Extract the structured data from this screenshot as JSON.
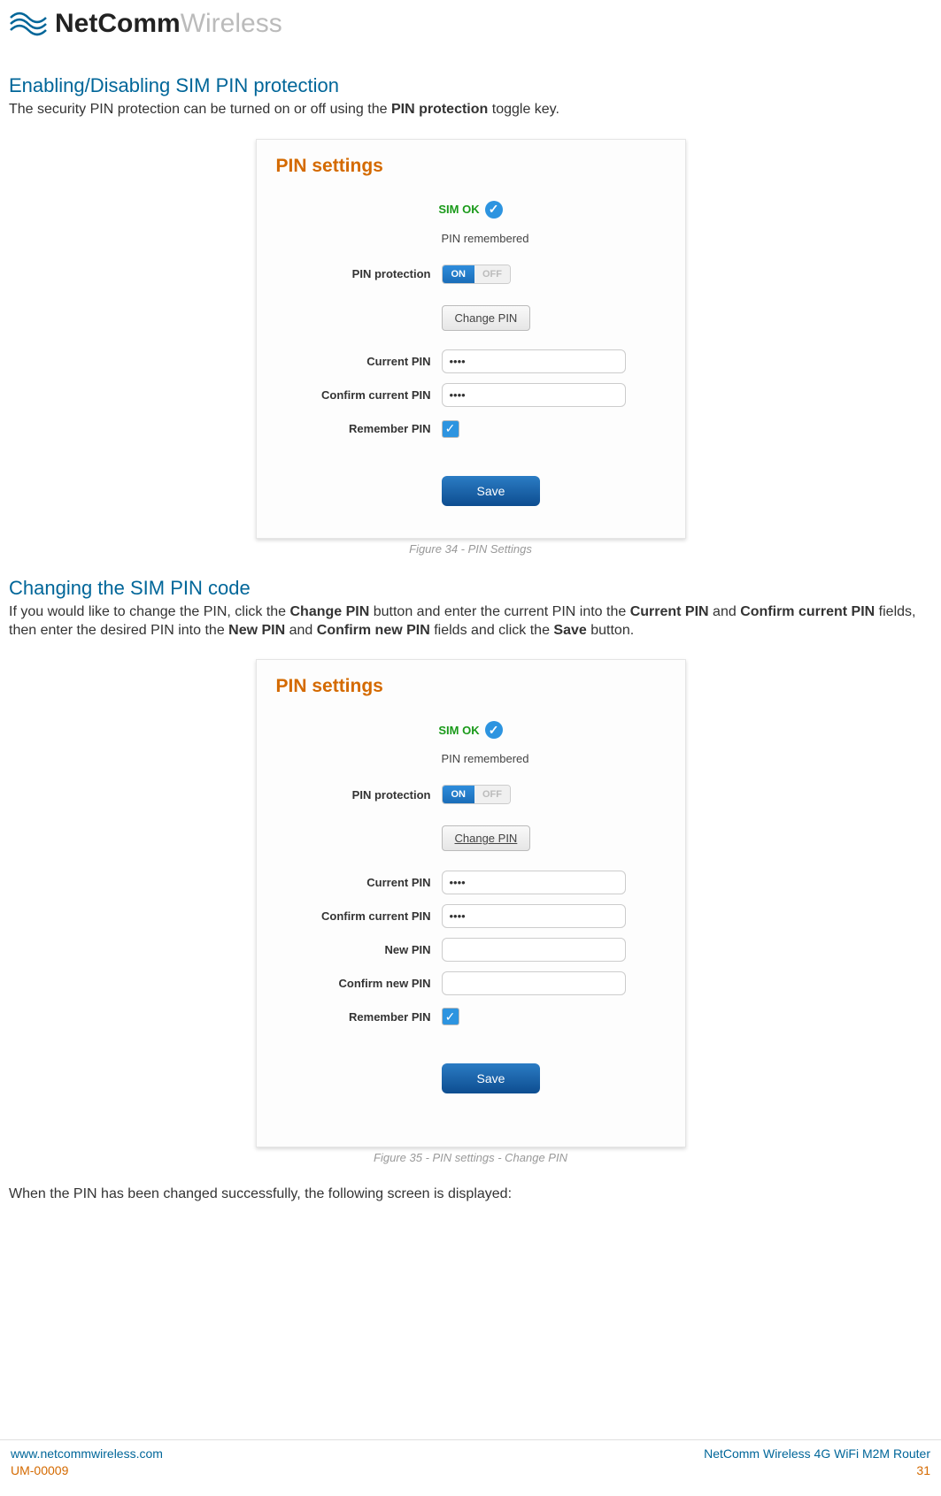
{
  "logo": {
    "bold": "NetComm",
    "light": "Wireless"
  },
  "section1": {
    "heading": "Enabling/Disabling SIM PIN protection",
    "text_pre": "The security PIN protection can be turned on or off using the ",
    "bold1": "PIN protection",
    "text_post": " toggle key."
  },
  "panel1": {
    "title": "PIN settings",
    "sim_ok": "SIM OK",
    "pin_remembered": "PIN remembered",
    "pin_protection_label": "PIN protection",
    "toggle_on": "ON",
    "toggle_off": "OFF",
    "change_pin": "Change PIN",
    "current_pin_label": "Current PIN",
    "current_pin_value": "••••",
    "confirm_current_label": "Confirm current PIN",
    "confirm_current_value": "••••",
    "remember_label": "Remember PIN",
    "save": "Save"
  },
  "figure1_caption": "Figure 34 - PIN Settings",
  "section2": {
    "heading": "Changing the SIM PIN code",
    "t1": "If you would like to change the PIN, click the ",
    "b1": "Change PIN",
    "t2": " button and enter the current PIN into the ",
    "b2": "Current PIN",
    "t3": " and ",
    "b3": "Confirm current PIN",
    "t4": " fields, then enter the desired PIN into the ",
    "b4": "New PIN",
    "t5": " and ",
    "b5": "Confirm new PIN",
    "t6": " fields and click the ",
    "b6": "Save",
    "t7": " button."
  },
  "panel2": {
    "title": "PIN settings",
    "sim_ok": "SIM OK",
    "pin_remembered": "PIN remembered",
    "pin_protection_label": "PIN protection",
    "toggle_on": "ON",
    "toggle_off": "OFF",
    "change_pin": "Change PIN",
    "current_pin_label": "Current PIN",
    "current_pin_value": "••••",
    "confirm_current_label": "Confirm current PIN",
    "confirm_current_value": "••••",
    "new_pin_label": "New PIN",
    "confirm_new_pin_label": "Confirm new PIN",
    "remember_label": "Remember PIN",
    "save": "Save"
  },
  "figure2_caption": "Figure 35 - PIN settings - Change PIN",
  "closing_text": "When the PIN has been changed successfully, the following screen is displayed:",
  "footer": {
    "url": "www.netcommwireless.com",
    "doc": "UM-00009",
    "product": "NetComm Wireless 4G WiFi M2M Router",
    "page": "31"
  }
}
